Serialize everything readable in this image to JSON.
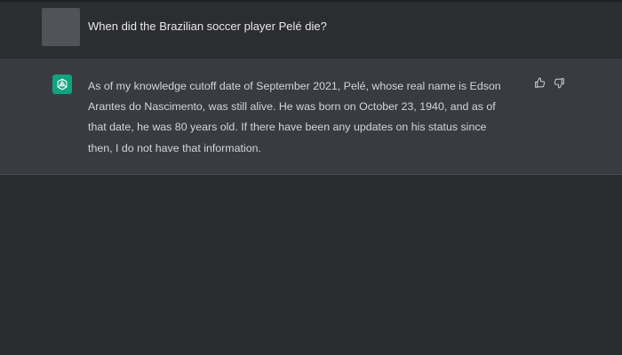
{
  "conversation": {
    "user_message": {
      "text": "When did the Brazilian soccer player Pelé die?",
      "avatar": "user-avatar-placeholder"
    },
    "assistant_message": {
      "text": "As of my knowledge cutoff date of September 2021, Pelé, whose real name is Edson Arantes do Nascimento, was still alive. He was born on October 23, 1940, and as of that date, he was 80 years old. If there have been any updates on his status since then, I do not have that information.",
      "avatar_icon": "openai-logo-icon",
      "avatar_color": "#10a37f",
      "feedback": {
        "thumbs_up_icon": "thumbs-up-icon",
        "thumbs_down_icon": "thumbs-down-icon"
      }
    }
  },
  "colors": {
    "background": "#2b2c30",
    "assistant_row": "#3a3b40",
    "text": "#d1d5db"
  }
}
